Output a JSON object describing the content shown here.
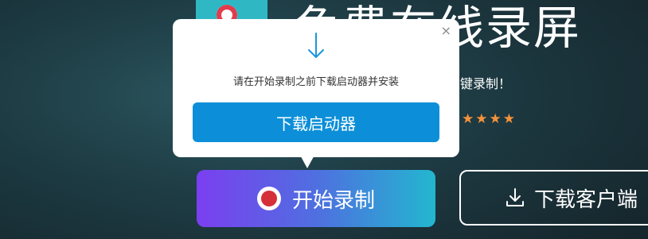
{
  "hero": {
    "title": "免费在线录屏",
    "subtitle": "键录制！",
    "stars": "★★★★"
  },
  "actions": {
    "start_label": "开始录制",
    "client_label": "下载客户端"
  },
  "popup": {
    "message": "请在开始录制之前下载启动器并安装",
    "download_label": "下载启动器",
    "close_glyph": "×"
  },
  "colors": {
    "accent_blue": "#0c8fd8",
    "gradient_start": "#7b3ff0",
    "gradient_end": "#22b7cf",
    "star_orange": "#f5923a",
    "record_red": "#d52f3a"
  },
  "icons": [
    "close-icon",
    "download-arrow-icon",
    "record-icon",
    "download-tray-icon"
  ]
}
